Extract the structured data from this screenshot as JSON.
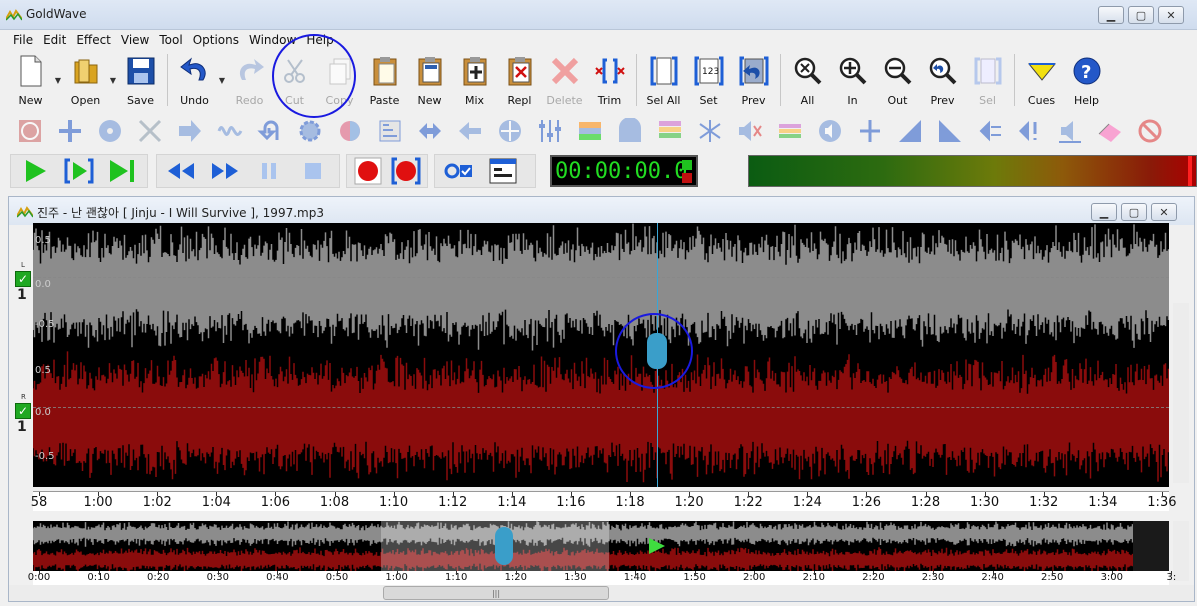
{
  "app": {
    "title": "GoldWave"
  },
  "menu": [
    "File",
    "Edit",
    "Effect",
    "View",
    "Tool",
    "Options",
    "Window",
    "Help"
  ],
  "toolbar": {
    "new_label": "New",
    "open_label": "Open",
    "save_label": "Save",
    "undo_label": "Undo",
    "redo_label": "Redo",
    "cut_label": "Cut",
    "copy_label": "Copy",
    "paste_label": "Paste",
    "pastenew_label": "New",
    "mix_label": "Mix",
    "replace_label": "Repl",
    "delete_label": "Delete",
    "trim_label": "Trim",
    "selall_label": "Sel All",
    "set_label": "Set",
    "prev_label": "Prev",
    "zoomall_label": "All",
    "zoomin_label": "In",
    "zoomout_label": "Out",
    "zoomprev_label": "Prev",
    "zoomsel_label": "Sel",
    "cues_label": "Cues",
    "help_label": "Help"
  },
  "transport": {
    "time": "00:00:00.0"
  },
  "document": {
    "title": "진주 - 난 괜찮아 [ Jinju - I Will Survive ], 1997.mp3"
  },
  "channels": {
    "left": {
      "letter": "L",
      "num": "1",
      "amp": [
        "0.5",
        "0.0",
        "-0.5"
      ]
    },
    "right": {
      "letter": "R",
      "num": "1",
      "amp": [
        "0.5",
        "0.0",
        "-0.5"
      ]
    }
  },
  "timeline": [
    "58",
    "1:00",
    "1:02",
    "1:04",
    "1:06",
    "1:08",
    "1:10",
    "1:12",
    "1:14",
    "1:16",
    "1:18",
    "1:20",
    "1:22",
    "1:24",
    "1:26",
    "1:28",
    "1:30",
    "1:32",
    "1:34",
    "1:36"
  ],
  "overview_timeline": [
    "0:00",
    "0:10",
    "0:20",
    "0:30",
    "0:40",
    "0:50",
    "1:00",
    "1:10",
    "1:20",
    "1:30",
    "1:40",
    "1:50",
    "2:00",
    "2:10",
    "2:20",
    "2:30",
    "2:40",
    "2:50",
    "3:00",
    "3:"
  ],
  "colors": {
    "left_wave": "#8c8c8c",
    "right_wave": "#8a0c0c",
    "cursor": "#39a6d6",
    "annotation": "#1a1ae0",
    "play_green": "#1fc21f",
    "record_red": "#e01010",
    "nav_blue": "#1e5fd6"
  }
}
